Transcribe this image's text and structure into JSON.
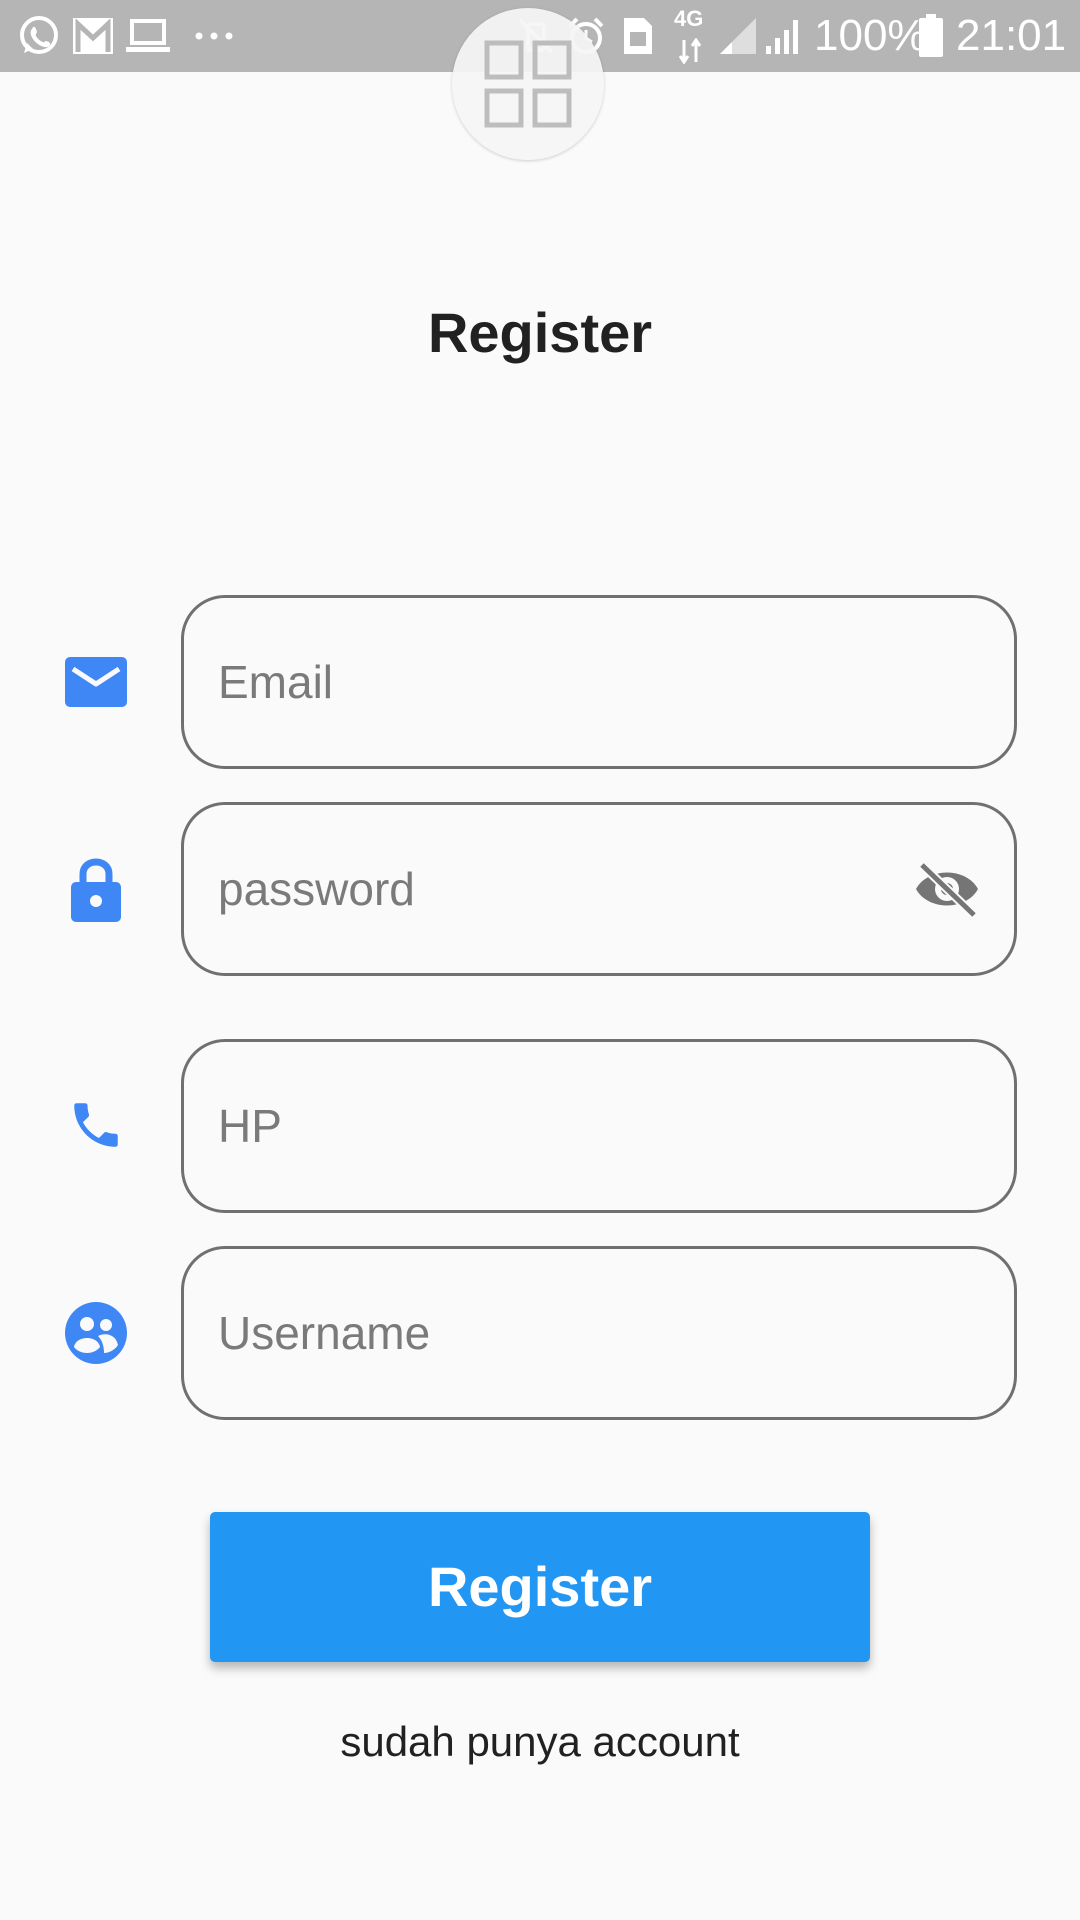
{
  "status_bar": {
    "battery_text": "100%",
    "time": "21:01",
    "network_label": "4G",
    "icons": [
      "whatsapp-icon",
      "gmail-icon",
      "laptop-icon",
      "more-dots-icon",
      "mute-vibrate-icon",
      "alarm-icon",
      "sim-icon",
      "signal-4g-icon",
      "signal-sim1-icon",
      "signal-sim2-icon",
      "battery-icon"
    ]
  },
  "floating_button": {
    "icon": "grid-icon"
  },
  "page": {
    "title": "Register"
  },
  "form": {
    "email": {
      "placeholder": "Email",
      "icon": "email-icon"
    },
    "password": {
      "placeholder": "password",
      "icon": "lock-icon",
      "toggle_icon": "visibility-off-icon"
    },
    "phone": {
      "placeholder": "HP",
      "icon": "phone-icon"
    },
    "username": {
      "placeholder": "Username",
      "icon": "group-icon"
    }
  },
  "actions": {
    "register_label": "Register",
    "login_link": "sudah punya account"
  },
  "colors": {
    "accent": "#2196f3",
    "icon_blue": "#3f87f5",
    "status_bar": "#b5b5b5",
    "background": "#fafafa"
  }
}
